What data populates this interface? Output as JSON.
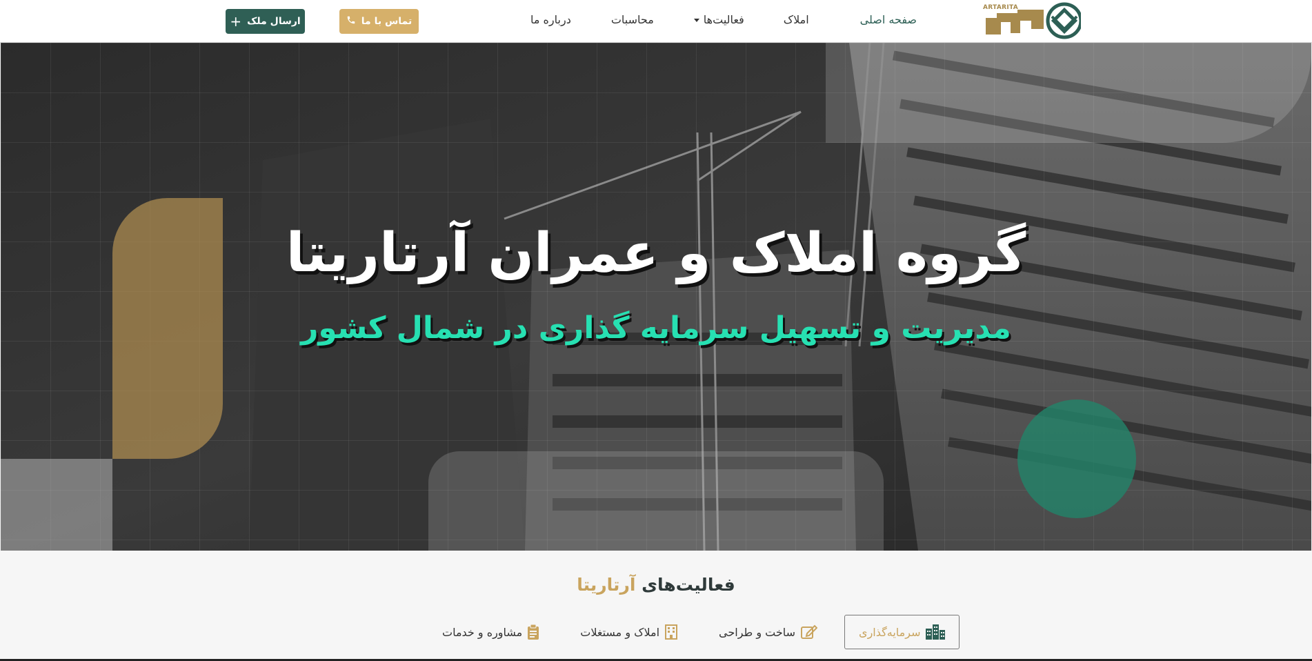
{
  "header": {
    "logo_text": "ARTARITA",
    "nav": [
      {
        "label": "صفحه اصلی",
        "active": true
      },
      {
        "label": "املاک",
        "active": false
      },
      {
        "label": "فعالیت‌ها",
        "active": false,
        "dropdown": true
      },
      {
        "label": "محاسبات",
        "active": false
      },
      {
        "label": "درباره ما",
        "active": false
      }
    ],
    "contact_button": "تماس با ما",
    "send_button": "ارسال ملک"
  },
  "hero": {
    "title": "گروه املاک و عمران آرتاریتا",
    "subtitle": "مدیریت و تسهیل سرمایه گذاری در شمال کشور"
  },
  "activities": {
    "title_prefix": "فعالیت‌های",
    "title_brand": "آرتاریتا",
    "tabs": [
      {
        "label": "سرمایه‌گذاری",
        "icon": "building-icon",
        "active": true
      },
      {
        "label": "ساخت و طراحی",
        "icon": "edit-icon",
        "active": false
      },
      {
        "label": "املاک و مستغلات",
        "icon": "office-building-icon",
        "active": false
      },
      {
        "label": "مشاوره و خدمات",
        "icon": "clipboard-icon",
        "active": false
      }
    ]
  },
  "colors": {
    "brand_green": "#2f5f55",
    "brand_gold": "#d6b06a",
    "hero_accent": "#27e0b2"
  }
}
